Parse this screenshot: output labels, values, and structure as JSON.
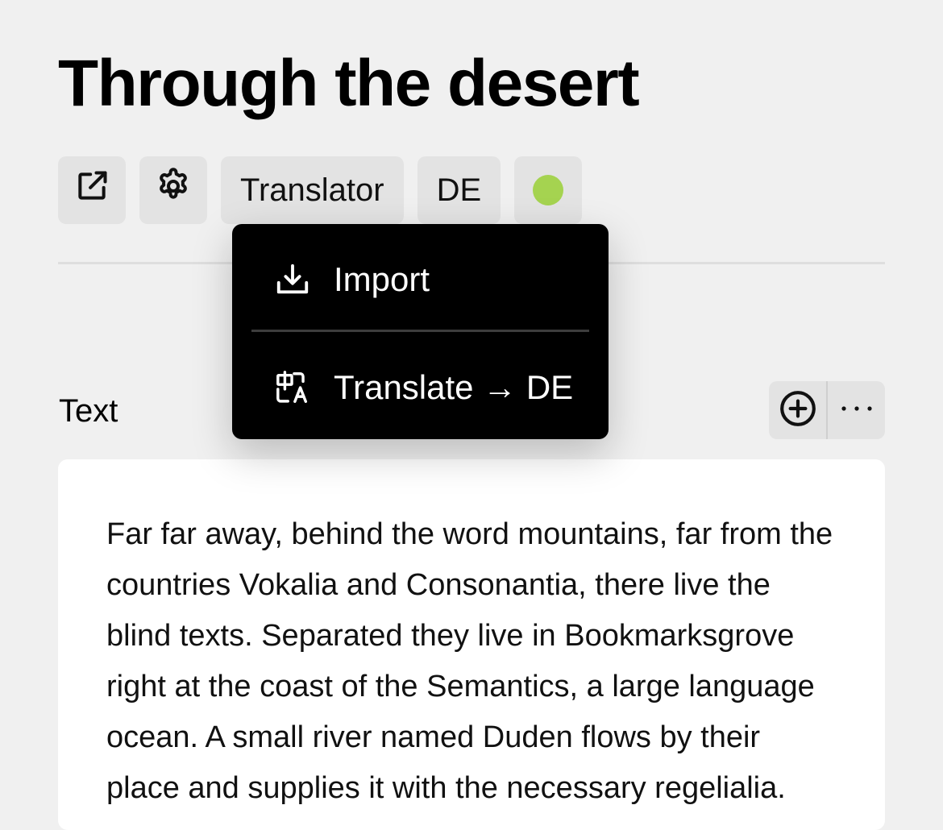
{
  "page": {
    "title": "Through the desert"
  },
  "toolbar": {
    "open_icon": "external-link-icon",
    "settings_icon": "gear-icon",
    "translator_label": "Translator",
    "language_label": "DE",
    "status_color": "#a5d350"
  },
  "menu": {
    "items": [
      {
        "icon": "download-icon",
        "label": "Import"
      },
      {
        "icon": "translate-icon",
        "label": "Translate → DE"
      }
    ]
  },
  "section": {
    "label": "Text",
    "add_icon": "plus-circle-icon",
    "more_icon": "ellipsis-icon"
  },
  "content": {
    "text": "Far far away, behind the word mountains, far from the countries Vokalia and Consonantia, there live the blind texts. Separated they live in Bookmarksgrove right at the coast of the Semantics, a large language ocean. A small river named Duden flows by their place and supplies it with the necessary regelialia."
  }
}
